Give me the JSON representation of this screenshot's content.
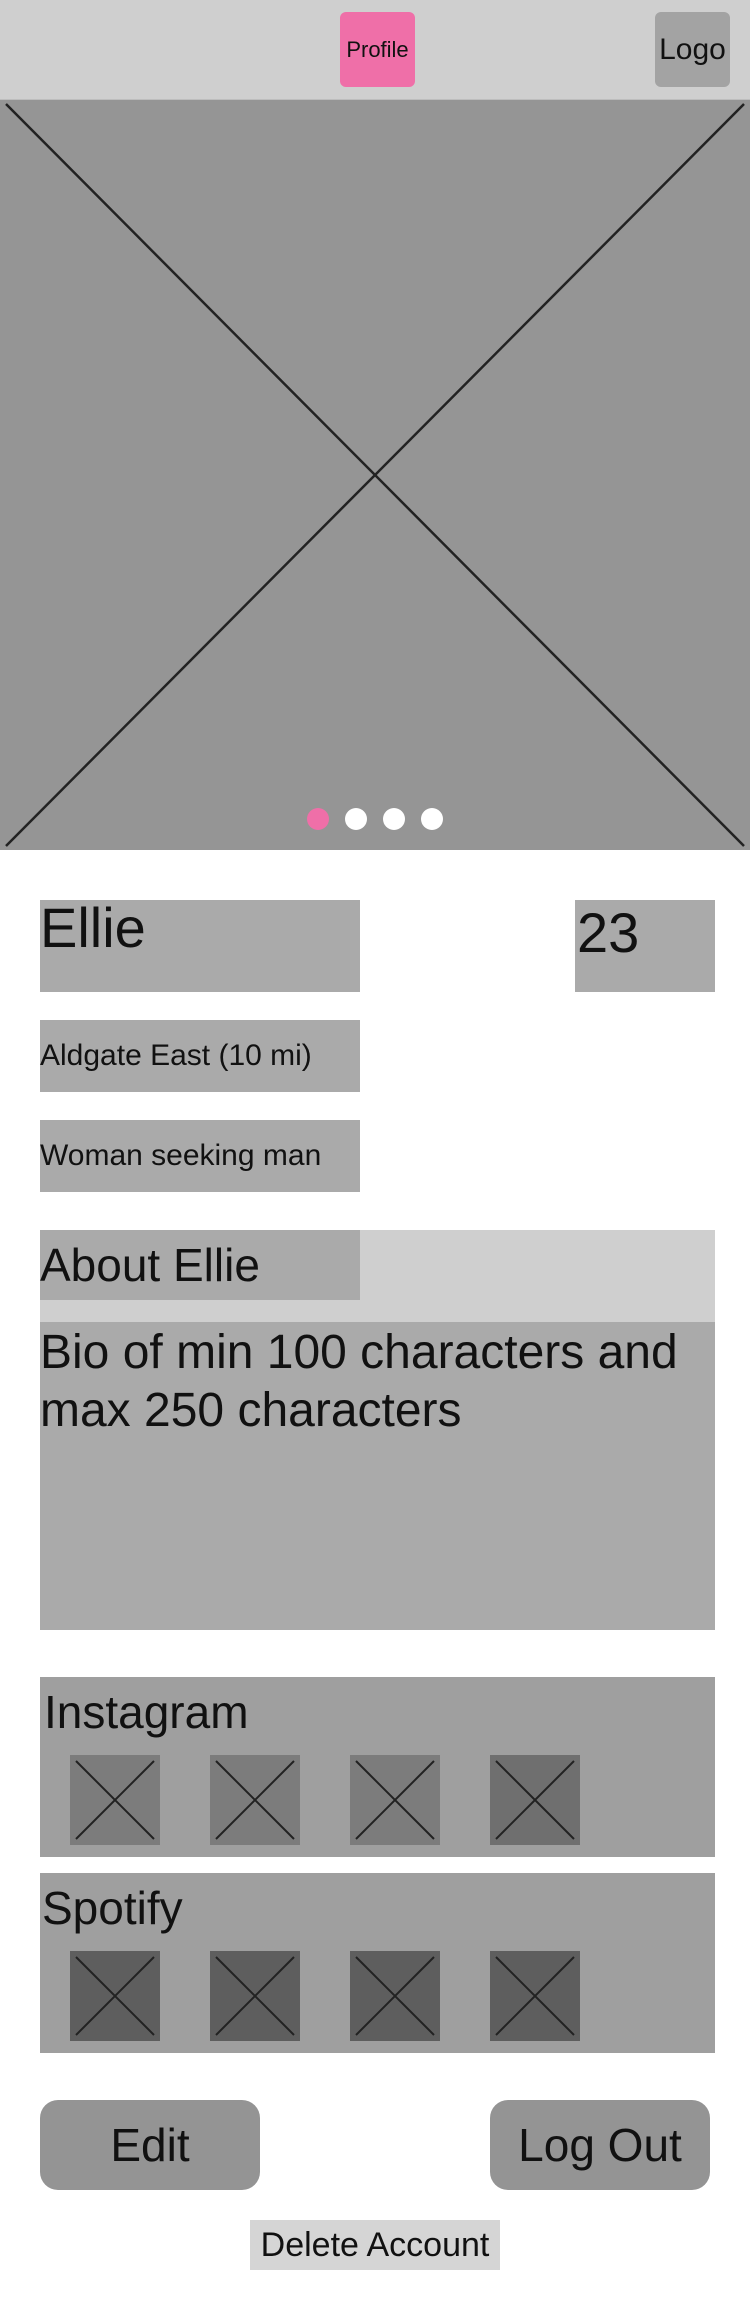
{
  "topbar": {
    "profile_label": "Profile",
    "logo_label": "Logo",
    "profile_color": "#ef6fa8"
  },
  "photo": {
    "placeholder_icon": "image-placeholder-x",
    "carousel_count": 4,
    "active_index": 0
  },
  "profile": {
    "name": "Ellie",
    "age": "23",
    "location": "Aldgate East (10 mi)",
    "seeking": "Woman seeking man"
  },
  "about": {
    "title": "About Ellie",
    "bio": "Bio of min 100 characters and max 250 characters"
  },
  "social": {
    "instagram": {
      "title": "Instagram",
      "thumbnail_icon": "image-placeholder-x",
      "thumbnail_count": 4
    },
    "spotify": {
      "title": "Spotify",
      "thumbnail_icon": "image-placeholder-x",
      "thumbnail_count": 4
    }
  },
  "actions": {
    "edit_label": "Edit",
    "logout_label": "Log Out",
    "delete_label": "Delete Account"
  }
}
